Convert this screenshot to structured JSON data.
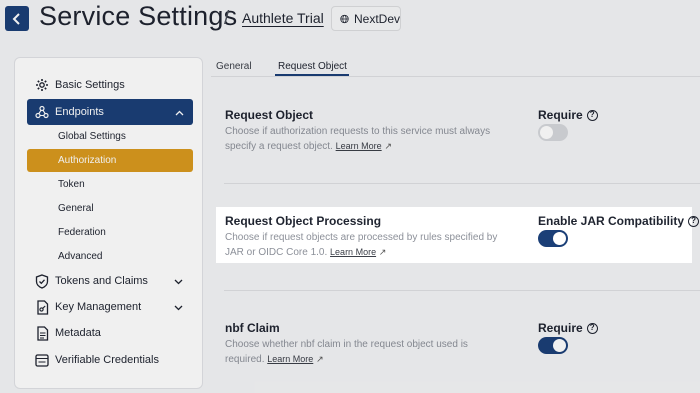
{
  "header": {
    "title": "Service Settings",
    "separator": "/",
    "service_name": "Authlete Trial",
    "environment": "NextDev"
  },
  "sidebar": {
    "items": [
      {
        "label": "Basic Settings",
        "icon": "gear-icon"
      },
      {
        "label": "Endpoints",
        "icon": "webhook-icon",
        "expanded": true
      },
      {
        "label": "Tokens and Claims",
        "icon": "shield-icon"
      },
      {
        "label": "Key Management",
        "icon": "key-file-icon"
      },
      {
        "label": "Metadata",
        "icon": "document-icon"
      },
      {
        "label": "Verifiable Credentials",
        "icon": "credential-icon"
      }
    ],
    "endpoint_subitems": [
      "Global Settings",
      "Authorization",
      "Token",
      "General",
      "Federation",
      "Advanced"
    ],
    "active_subitem": "Authorization"
  },
  "tabs": [
    "General",
    "Request Object"
  ],
  "active_tab": "Request Object",
  "settings": [
    {
      "title": "Request Object",
      "description_line1": "Choose if authorization requests to this service must always",
      "description_line2": "specify a request object.",
      "learn_more": "Learn More",
      "control_label": "Require",
      "enabled": false
    },
    {
      "title": "Request Object Processing",
      "description_line1": "Choose if request objects are processed by rules specified by",
      "description_line2": "JAR or OIDC Core 1.0.",
      "learn_more": "Learn More",
      "control_label": "Enable JAR Compatibility",
      "enabled": true
    },
    {
      "title": "nbf Claim",
      "description_line1": "Choose whether nbf claim in the request object used is",
      "description_line2": "required.",
      "learn_more": "Learn More",
      "control_label": "Require",
      "enabled": true
    }
  ],
  "colors": {
    "primary": "#1b3f77",
    "active_item": "#d99a1e",
    "background": "#f4f5f7"
  }
}
